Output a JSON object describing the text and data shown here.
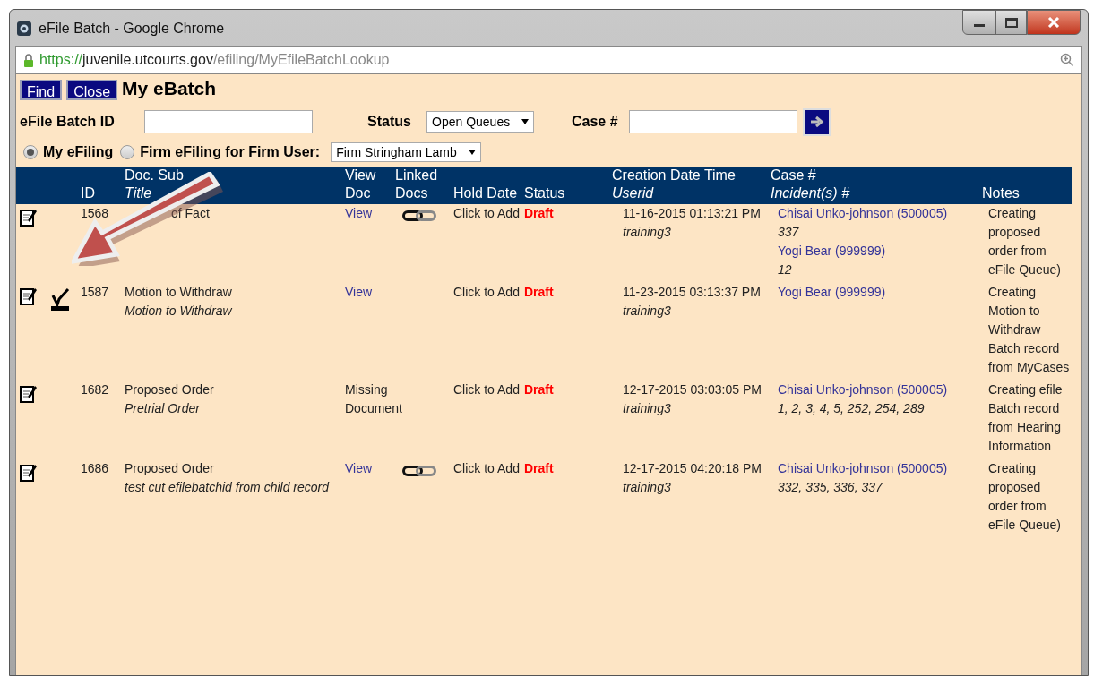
{
  "window": {
    "title": "eFile Batch - Google Chrome"
  },
  "address_bar": {
    "scheme": "https://",
    "host": "juvenile.utcourts.gov",
    "path": "/efiling/MyEfileBatchLookup"
  },
  "toolbar": {
    "buttons": [
      "Find",
      "Close"
    ],
    "heading": "My eBatch"
  },
  "filters": {
    "batch_id": {
      "label": "eFile Batch ID"
    },
    "status": {
      "label": "Status",
      "value": "Open Queues"
    },
    "case": {
      "label": "Case #"
    }
  },
  "scope": {
    "options": [
      {
        "label": "My eFiling",
        "selected": true
      },
      {
        "label": "Firm eFiling for Firm User:",
        "selected": false
      }
    ],
    "firm": "Firm Stringham Lamb"
  },
  "table": {
    "columns": [
      {
        "bottom": "ID"
      },
      {
        "top": "Doc. Sub",
        "bottom": "Title"
      },
      {
        "top": "View",
        "bottom": "Doc"
      },
      {
        "top": "Linked",
        "bottom": "Docs"
      },
      {
        "bottom": "Hold Date"
      },
      {
        "bottom": "Status"
      },
      {
        "top": "Creation Date Time",
        "bottom": "Userid"
      },
      {
        "top": "Case #",
        "bottom": "Incident(s) #"
      },
      {
        "bottom": "Notes"
      }
    ],
    "rows": [
      {
        "stamp": false,
        "id": "1568",
        "subtype": "of Fact",
        "view": {
          "kind": "link",
          "text": "View"
        },
        "linked": true,
        "hold": "Click to Add",
        "status": "Draft",
        "created": "11-16-2015 01:13:21 PM",
        "userid": "training3",
        "cases": [
          {
            "name": "Chisai Unko-johnson (500005)",
            "incidents": "337"
          },
          {
            "name": "Yogi Bear (999999)",
            "incidents": "12"
          }
        ],
        "notes": "Creating proposed order from eFile Queue)"
      },
      {
        "stamp": true,
        "id": "1587",
        "subtype": "Motion to Withdraw",
        "title": "Motion to Withdraw",
        "view": {
          "kind": "link",
          "text": "View"
        },
        "linked": false,
        "hold": "Click to Add",
        "status": "Draft",
        "created": "11-23-2015 03:13:37 PM",
        "userid": "training3",
        "cases": [
          {
            "name": "Yogi Bear (999999)"
          }
        ],
        "notes": "Creating Motion to Withdraw Batch record from MyCases"
      },
      {
        "stamp": false,
        "id": "1682",
        "subtype": "Proposed Order",
        "title": "Pretrial Order",
        "view": {
          "kind": "missing",
          "text": "Missing Document"
        },
        "linked": false,
        "hold": "Click to Add",
        "status": "Draft",
        "created": "12-17-2015 03:03:05 PM",
        "userid": "training3",
        "cases": [
          {
            "name": "Chisai Unko-johnson (500005)",
            "incidents": "1, 2, 3, 4, 5, 252, 254, 289"
          }
        ],
        "notes": "Creating efile Batch record from Hearing Information"
      },
      {
        "stamp": false,
        "id": "1686",
        "subtype": "Proposed Order",
        "title": "test cut efilebatchid from child record",
        "view": {
          "kind": "link",
          "text": "View"
        },
        "linked": true,
        "hold": "Click to Add",
        "status": "Draft",
        "created": "12-17-2015 04:20:18 PM",
        "userid": "training3",
        "cases": [
          {
            "name": "Chisai Unko-johnson (500005)",
            "incidents": "332, 335, 336, 337"
          }
        ],
        "notes": "Creating proposed order from eFile Queue)"
      }
    ]
  }
}
